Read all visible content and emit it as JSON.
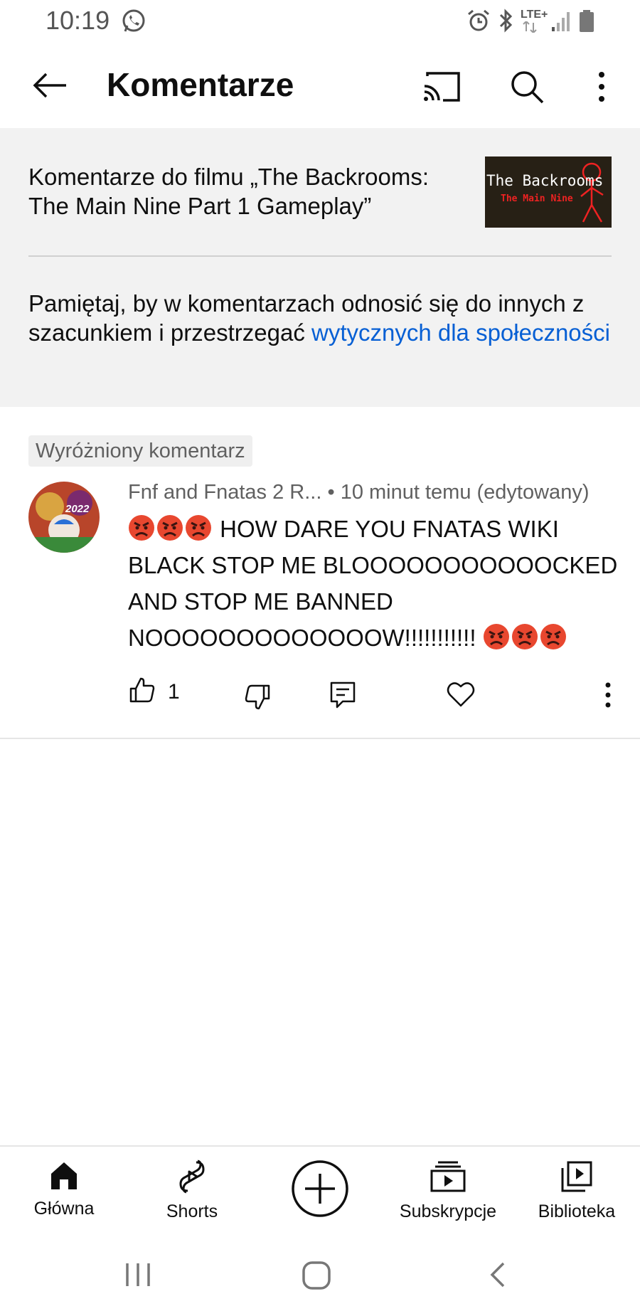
{
  "status_bar": {
    "time": "10:19",
    "icons": [
      "whatsapp-icon",
      "alarm-icon",
      "bluetooth-icon",
      "lte-icon",
      "signal-icon",
      "battery-icon"
    ],
    "network_label": "LTE+"
  },
  "header": {
    "title": "Komentarze",
    "icons": [
      "back-arrow-icon",
      "cast-icon",
      "search-icon",
      "more-vert-icon"
    ]
  },
  "video_info": {
    "text": "Komentarze do filmu „The Backrooms: The Main Nine Part 1 Gameplay”",
    "thumbnail_title": "The Backrooms",
    "thumbnail_subtitle": "The Main Nine"
  },
  "guideline": {
    "text": "Pamiętaj, by w komentarzach odnosić się do innych z szacunkiem i przestrzegać ",
    "link_text": "wytycznych dla społeczności",
    "link_color": "#065fd4"
  },
  "comment": {
    "badge": "Wyróżniony komentarz",
    "author": "Fnf and Fnatas 2 R...",
    "separator": " • ",
    "time": "10 minut temu (edytowany)",
    "body": "HOW DARE YOU FNATAS WIKI BLACK STOP ME BLOOOOOOOOOOOCKED AND STOP ME BANNED NOOOOOOOOOOOOOW!!!!!!!!!!!",
    "emoji_name": "angry-face-emoji",
    "likes": "1",
    "avatar_text": "2022",
    "actions": [
      "like-icon",
      "dislike-icon",
      "reply-icon",
      "heart-icon",
      "more-vert-icon"
    ]
  },
  "bottom_nav": {
    "items": [
      {
        "label": "Główna",
        "icon": "home-icon"
      },
      {
        "label": "Shorts",
        "icon": "shorts-icon"
      },
      {
        "label": "",
        "icon": "create-plus-icon"
      },
      {
        "label": "Subskrypcje",
        "icon": "subscriptions-icon"
      },
      {
        "label": "Biblioteka",
        "icon": "library-icon"
      }
    ]
  },
  "system_nav": {
    "icons": [
      "recent-apps-icon",
      "home-circle-icon",
      "system-back-icon"
    ]
  }
}
